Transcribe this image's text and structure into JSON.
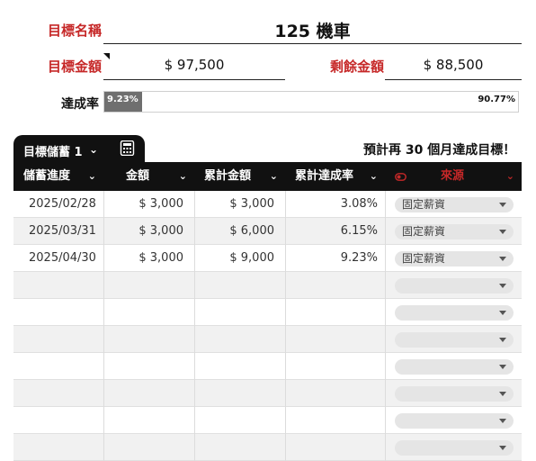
{
  "goal": {
    "name_label": "目標名稱",
    "name_value": "125 機車",
    "amount_label": "目標金額",
    "amount_value": "$ 97,500",
    "remaining_label": "剩餘金額",
    "remaining_value": "$ 88,500",
    "rate_label": "達成率",
    "rate_done": "9.23%",
    "rate_done_fraction": 0.0923,
    "rate_left": "90.77%"
  },
  "tab": {
    "label": "目標儲蓄 1",
    "chevron_icon": "chevron-down-icon",
    "calc_icon": "calculator-icon"
  },
  "forecast": "預計再 30 個月達成目標！",
  "table": {
    "columns": [
      {
        "label": "儲蓄進度",
        "chevron": "⌄"
      },
      {
        "label": "金額",
        "chevron": "⌄"
      },
      {
        "label": "累計金額",
        "chevron": "⌄"
      },
      {
        "label": "累計達成率",
        "chevron": "⌄"
      },
      {
        "label": "來源",
        "chevron": "⌄",
        "color": "#c62828"
      }
    ],
    "rows": [
      {
        "date": "2025/02/28",
        "amount": "$ 3,000",
        "cumulative": "$ 3,000",
        "rate": "3.08%",
        "source": "固定薪資"
      },
      {
        "date": "2025/03/31",
        "amount": "$ 3,000",
        "cumulative": "$ 6,000",
        "rate": "6.15%",
        "source": "固定薪資"
      },
      {
        "date": "2025/04/30",
        "amount": "$ 3,000",
        "cumulative": "$ 9,000",
        "rate": "9.23%",
        "source": "固定薪資"
      },
      {
        "date": "",
        "amount": "",
        "cumulative": "",
        "rate": "",
        "source": ""
      },
      {
        "date": "",
        "amount": "",
        "cumulative": "",
        "rate": "",
        "source": ""
      },
      {
        "date": "",
        "amount": "",
        "cumulative": "",
        "rate": "",
        "source": ""
      },
      {
        "date": "",
        "amount": "",
        "cumulative": "",
        "rate": "",
        "source": ""
      },
      {
        "date": "",
        "amount": "",
        "cumulative": "",
        "rate": "",
        "source": ""
      },
      {
        "date": "",
        "amount": "",
        "cumulative": "",
        "rate": "",
        "source": ""
      },
      {
        "date": "",
        "amount": "",
        "cumulative": "",
        "rate": "",
        "source": ""
      }
    ]
  },
  "colors": {
    "accent_red": "#c62828",
    "header_bg": "#111111",
    "progress_fill": "#6f6f6f"
  }
}
